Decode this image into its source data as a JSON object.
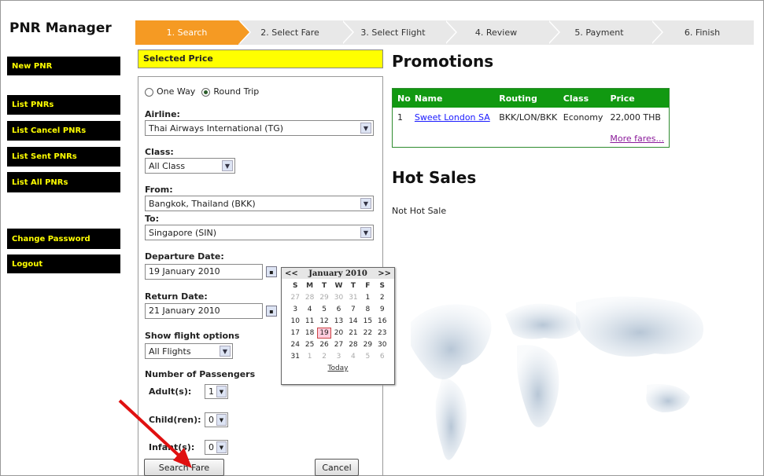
{
  "app": {
    "title": "PNR Manager"
  },
  "nav": {
    "new_pnr": "New PNR",
    "list_pnrs": "List PNRs",
    "list_cancel_pnrs": "List Cancel PNRs",
    "list_sent_pnrs": "List Sent PNRs",
    "list_all_pnrs": "List All PNRs",
    "change_password": "Change Password",
    "logout": "Logout"
  },
  "steps": [
    {
      "label": "1. Search",
      "active": true
    },
    {
      "label": "2. Select Fare",
      "active": false
    },
    {
      "label": "3. Select Flight",
      "active": false
    },
    {
      "label": "4. Review",
      "active": false
    },
    {
      "label": "5. Payment",
      "active": false
    },
    {
      "label": "6. Finish",
      "active": false
    }
  ],
  "form": {
    "header": "Selected Price",
    "trip_type": {
      "one_way": "One Way",
      "round_trip": "Round Trip",
      "selected": "Round Trip"
    },
    "airline": {
      "label": "Airline:",
      "value": "Thai Airways International (TG)"
    },
    "class": {
      "label": "Class:",
      "value": "All Class"
    },
    "from": {
      "label": "From:",
      "value": "Bangkok, Thailand (BKK)"
    },
    "to": {
      "label": "To:",
      "value": "Singapore (SIN)"
    },
    "departure": {
      "label": "Departure Date:",
      "value": "19 January 2010"
    },
    "return": {
      "label": "Return Date:",
      "value": "21 January 2010"
    },
    "flight_options": {
      "label": "Show flight options",
      "value": "All Flights"
    },
    "passengers": {
      "label": "Number of Passengers",
      "adult": {
        "label": "Adult(s):",
        "value": "1"
      },
      "child": {
        "label": "Child(ren):",
        "value": "0"
      },
      "infant": {
        "label": "Infant(s):",
        "value": "0"
      }
    },
    "search_button": "Search Fare",
    "cancel_button": "Cancel"
  },
  "calendar": {
    "prev": "<<",
    "next": ">>",
    "month": "January 2010",
    "dow": [
      "S",
      "M",
      "T",
      "W",
      "T",
      "F",
      "S"
    ],
    "today_label": "Today",
    "selected_day": "19"
  },
  "promotions": {
    "title": "Promotions",
    "columns": [
      "No",
      "Name",
      "Routing",
      "Class",
      "Price"
    ],
    "rows": [
      {
        "no": "1",
        "name": "Sweet London SA",
        "routing": "BKK/LON/BKK",
        "class": "Economy",
        "price": "22,000 THB"
      }
    ],
    "more": "More fares..."
  },
  "hot_sales": {
    "title": "Hot Sales",
    "empty": "Not Hot Sale"
  },
  "colors": {
    "accent_step": "#f59a23",
    "nav_bg": "#000000",
    "nav_text": "#ffff00",
    "promo_header": "#119911",
    "highlight": "#ffff00"
  }
}
